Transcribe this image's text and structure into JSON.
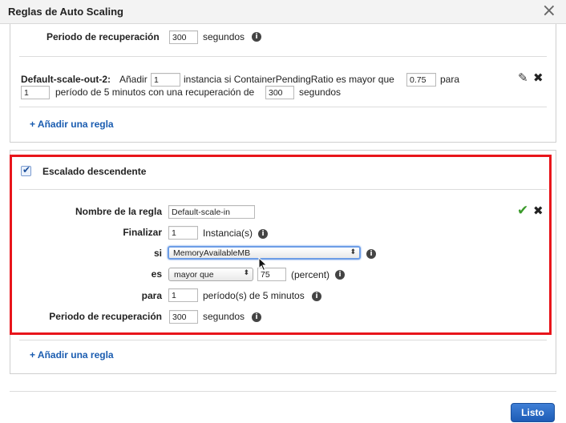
{
  "dialog": {
    "title": "Reglas de Auto Scaling",
    "close_symbol": "×"
  },
  "top_section": {
    "cooldown_label": "Periodo de recuperación",
    "cooldown_value": "300",
    "cooldown_unit": "segundos",
    "rule": {
      "name": "Default-scale-out-2:",
      "text_add": "Añadir",
      "instances_value": "1",
      "text_condition": "instancia si ContainerPendingRatio es mayor que",
      "threshold_value": "0.75",
      "text_para": "para",
      "periods_value": "1",
      "text_periods": "período de 5 minutos con una recuperación de",
      "cooldown_value": "300",
      "cooldown_unit": "segundos"
    },
    "add_rule_link": "+ Añadir una regla"
  },
  "scale_in_section": {
    "header": "Escalado descendente",
    "checked": true,
    "rule_name_label": "Nombre de la regla",
    "rule_name_value": "Default-scale-in",
    "terminate_label": "Finalizar",
    "terminate_value": "1",
    "terminate_unit": "Instancia(s)",
    "if_label": "si",
    "metric_selected": "MemoryAvailableMB",
    "is_label": "es",
    "operator_selected": "mayor que",
    "threshold_value": "75",
    "threshold_unit": "(percent)",
    "for_label": "para",
    "periods_value": "1",
    "periods_unit": "período(s) de 5 minutos",
    "cooldown_label": "Periodo de recuperación",
    "cooldown_value": "300",
    "cooldown_unit": "segundos",
    "add_rule_link": "+ Añadir una regla"
  },
  "footer": {
    "done_button": "Listo"
  },
  "colors": {
    "highlight": "#e8151b",
    "primary_button": "#1d5cb6",
    "link": "#1a5cb0",
    "confirm": "#3a9a2a"
  },
  "icons": [
    "close-icon",
    "info-icon",
    "edit-pencil-icon",
    "delete-icon",
    "confirm-check-icon",
    "checkbox-check-icon",
    "select-arrows-icon",
    "mouse-cursor-icon"
  ]
}
